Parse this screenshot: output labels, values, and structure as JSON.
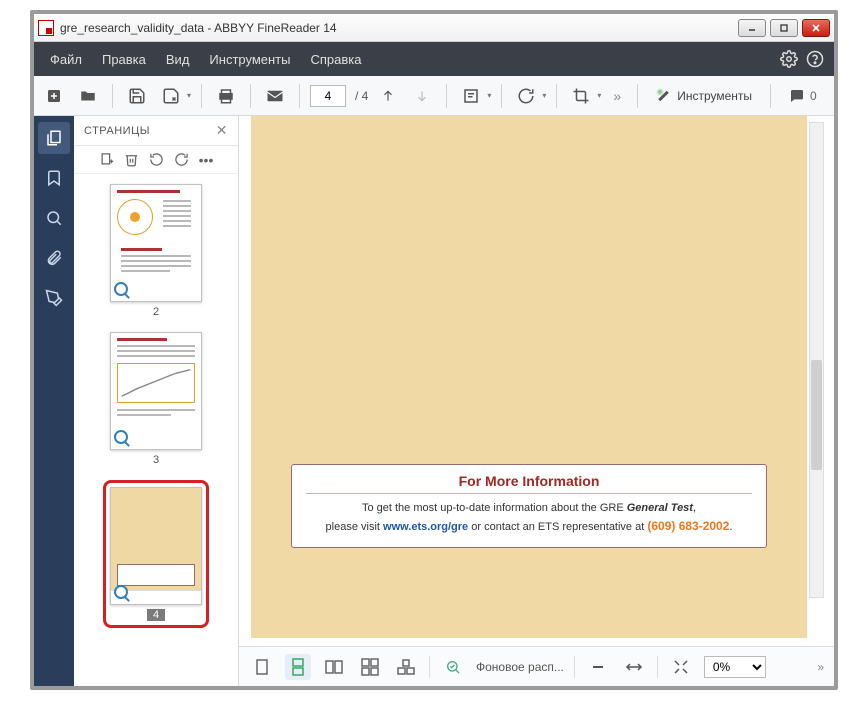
{
  "window": {
    "title": "gre_research_validity_data - ABBYY FineReader 14"
  },
  "menu": {
    "file": "Файл",
    "edit": "Правка",
    "view": "Вид",
    "tools": "Инструменты",
    "help": "Справка"
  },
  "toolbar": {
    "page_current": "4",
    "page_total": "/ 4",
    "tools_label": "Инструменты",
    "comments_count": "0",
    "more": "»"
  },
  "pages_panel": {
    "title": "СТРАНИЦЫ",
    "thumbs": [
      {
        "num": "2"
      },
      {
        "num": "3"
      },
      {
        "num": "4"
      }
    ]
  },
  "document": {
    "info_title": "For More Information",
    "info_line1_a": "To get the most up-to-date information about the GRE ",
    "info_line1_b": "General Test",
    "info_line1_c": ",",
    "info_line2_a": "please visit ",
    "info_link": "www.ets.org/gre",
    "info_line2_b": " or contact an ETS representative at ",
    "info_phone": "(609) 683-2002",
    "info_line2_c": "."
  },
  "viewstrip": {
    "mode_label": "Фоновое расп...",
    "zoom_value": "0%",
    "more": "»"
  }
}
